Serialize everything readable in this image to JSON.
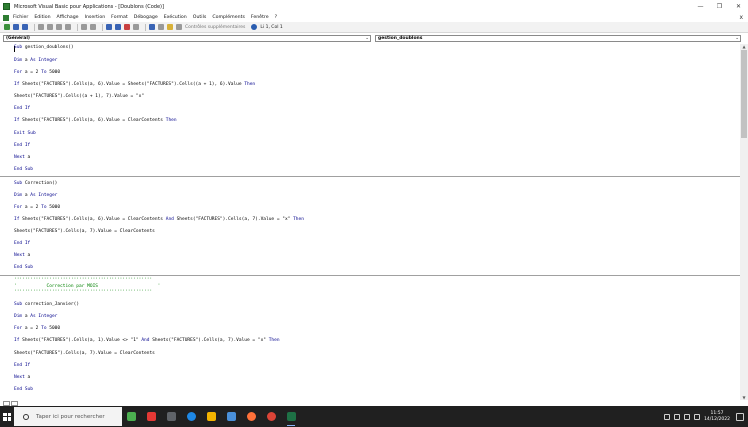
{
  "window": {
    "title": "Microsoft Visual Basic pour Applications - [Doublons (Code)]",
    "controls": {
      "minimize": "—",
      "restore": "❐",
      "close": "✕"
    }
  },
  "menu": {
    "items": [
      "Fichier",
      "Edition",
      "Affichage",
      "Insertion",
      "Format",
      "Débogage",
      "Exécution",
      "Outils",
      "Compléments",
      "Fenêtre",
      "?"
    ],
    "close_glyph": "x"
  },
  "toolbar": {
    "controls_label": "Contrôles supplémentaires",
    "position_label": "Li 1, Col 1"
  },
  "combos": {
    "object": "(Général)",
    "procedure": "gestion_doublons"
  },
  "code": {
    "lines": [
      {
        "segments": [
          {
            "t": "Sub",
            "kw": true
          },
          {
            "t": " gestion_doublons()"
          }
        ]
      },
      {
        "segments": [
          {
            "t": "Dim",
            "kw": true
          },
          {
            "t": " a "
          },
          {
            "t": "As Integer",
            "kw": true
          }
        ]
      },
      {
        "segments": [
          {
            "t": "For",
            "kw": true
          },
          {
            "t": " a = 2 "
          },
          {
            "t": "To",
            "kw": true
          },
          {
            "t": " 5000"
          }
        ]
      },
      {
        "segments": [
          {
            "t": "If",
            "kw": true
          },
          {
            "t": " Sheets(\"FACTURES\").Cells(a, 6).Value = Sheets(\"FACTURES\").Cells((a + 1), 6).Value "
          },
          {
            "t": "Then",
            "kw": true
          }
        ]
      },
      {
        "segments": [
          {
            "t": "Sheets(\"FACTURES\").Cells((a + 1), 7).Value = \"x\""
          }
        ]
      },
      {
        "segments": [
          {
            "t": "End If",
            "kw": true
          }
        ]
      },
      {
        "segments": [
          {
            "t": "If",
            "kw": true
          },
          {
            "t": " Sheets(\"FACTURES\").Cells(a, 6).Value = ClearContents "
          },
          {
            "t": "Then",
            "kw": true
          }
        ]
      },
      {
        "segments": [
          {
            "t": "Exit Sub",
            "kw": true
          }
        ]
      },
      {
        "segments": [
          {
            "t": "End If",
            "kw": true
          }
        ]
      },
      {
        "segments": [
          {
            "t": "Next",
            "kw": true
          },
          {
            "t": " a"
          }
        ]
      },
      {
        "segments": [
          {
            "t": "End Sub",
            "kw": true
          }
        ]
      },
      {
        "segments": [
          {
            "t": "Sub",
            "kw": true
          },
          {
            "t": " Correction()"
          }
        ]
      },
      {
        "segments": [
          {
            "t": "Dim",
            "kw": true
          },
          {
            "t": " a "
          },
          {
            "t": "As Integer",
            "kw": true
          }
        ]
      },
      {
        "segments": [
          {
            "t": "For",
            "kw": true
          },
          {
            "t": " a = 2 "
          },
          {
            "t": "To",
            "kw": true
          },
          {
            "t": " 5000"
          }
        ]
      },
      {
        "segments": [
          {
            "t": "If",
            "kw": true
          },
          {
            "t": " Sheets(\"FACTURES\").Cells(a, 6).Value = ClearContents "
          },
          {
            "t": "And",
            "kw": true
          },
          {
            "t": " Sheets(\"FACTURES\").Cells(a, 7).Value = \"x\" "
          },
          {
            "t": "Then",
            "kw": true
          }
        ]
      },
      {
        "segments": [
          {
            "t": "Sheets(\"FACTURES\").Cells(a, 7).Value = ClearContents"
          }
        ]
      },
      {
        "segments": [
          {
            "t": "End If",
            "kw": true
          }
        ]
      },
      {
        "segments": [
          {
            "t": "Next",
            "kw": true
          },
          {
            "t": " a"
          }
        ]
      },
      {
        "segments": [
          {
            "t": "End Sub",
            "kw": true
          }
        ]
      },
      {
        "comment": true,
        "segments": [
          {
            "t": "'''''''''''''''''''''''''''''''''''''''''''''''''''"
          }
        ]
      },
      {
        "comment": true,
        "segments": [
          {
            "t": "'           Correction par MOIS                      '"
          }
        ]
      },
      {
        "comment": true,
        "segments": [
          {
            "t": "'''''''''''''''''''''''''''''''''''''''''''''''''''"
          }
        ]
      },
      {
        "segments": [
          {
            "t": "Sub",
            "kw": true
          },
          {
            "t": " correction_Janvier()"
          }
        ]
      },
      {
        "segments": [
          {
            "t": "Dim",
            "kw": true
          },
          {
            "t": " a "
          },
          {
            "t": "As Integer",
            "kw": true
          }
        ]
      },
      {
        "segments": [
          {
            "t": "For",
            "kw": true
          },
          {
            "t": " a = 2 "
          },
          {
            "t": "To",
            "kw": true
          },
          {
            "t": " 5000"
          }
        ]
      },
      {
        "segments": [
          {
            "t": "If",
            "kw": true
          },
          {
            "t": " Sheets(\"FACTURES\").Cells(a, 1).Value <> \"1\" "
          },
          {
            "t": "And",
            "kw": true
          },
          {
            "t": " Sheets(\"FACTURES\").Cells(a, 7).Value = \"x\" "
          },
          {
            "t": "Then",
            "kw": true
          }
        ]
      },
      {
        "segments": [
          {
            "t": "Sheets(\"FACTURES\").Cells(a, 7).Value = ClearContents"
          }
        ]
      },
      {
        "segments": [
          {
            "t": "End If",
            "kw": true
          }
        ]
      },
      {
        "segments": [
          {
            "t": "Next",
            "kw": true
          },
          {
            "t": " a"
          }
        ]
      },
      {
        "segments": [
          {
            "t": "End Sub",
            "kw": true
          }
        ]
      }
    ]
  },
  "taskbar": {
    "search_placeholder": "Taper ici pour rechercher",
    "time": "11:57",
    "date": "14/12/2022"
  },
  "colors": {
    "keyword": "#00008b",
    "comment": "#008000",
    "taskbar": "#202020"
  }
}
